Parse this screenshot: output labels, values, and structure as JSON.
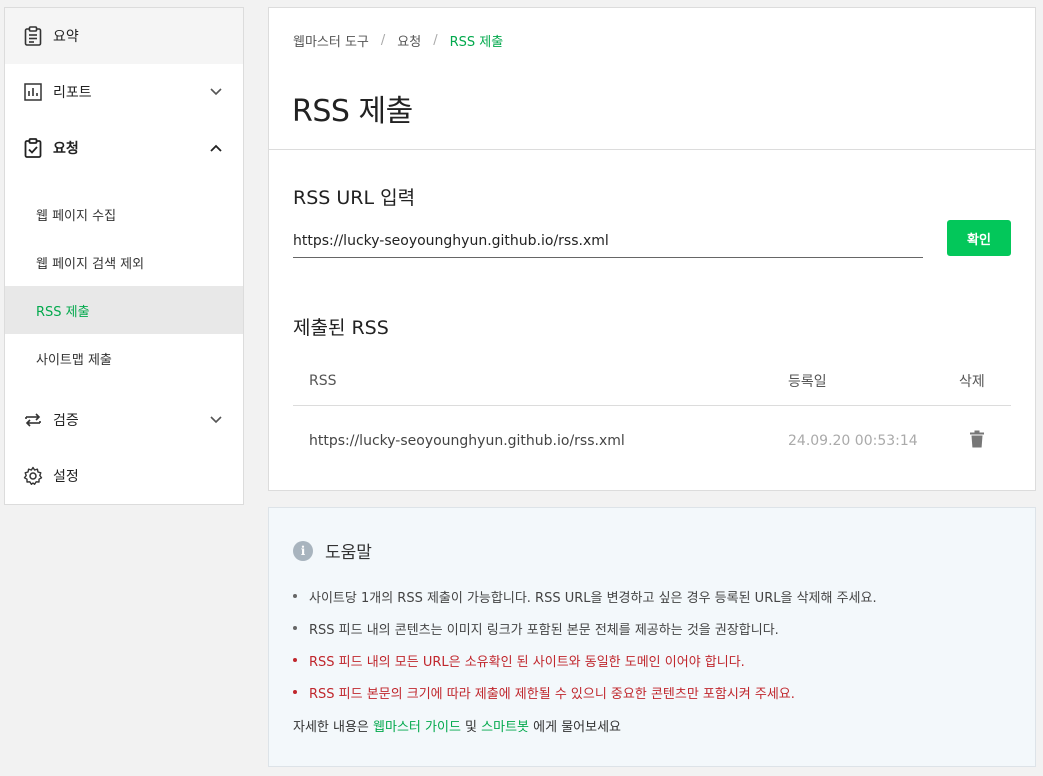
{
  "sidebar": {
    "summary": "요약",
    "reports": "리포트",
    "requests": "요청",
    "sub_items": [
      "웹 페이지 수집",
      "웹 페이지 검색 제외",
      "RSS 제출",
      "사이트맵 제출"
    ],
    "verify": "검증",
    "settings": "설정"
  },
  "breadcrumb": {
    "root": "웹마스터 도구",
    "sep": "/",
    "mid": "요청",
    "current": "RSS 제출"
  },
  "page_title": "RSS 제출",
  "input_section": {
    "title": "RSS URL 입력",
    "value": "https://lucky-seoyounghyun.github.io/rss.xml",
    "button": "확인"
  },
  "submitted": {
    "title": "제출된 RSS",
    "headers": {
      "rss": "RSS",
      "date": "등록일",
      "delete": "삭제"
    },
    "rows": [
      {
        "rss": "https://lucky-seoyounghyun.github.io/rss.xml",
        "date": "24.09.20 00:53:14"
      }
    ]
  },
  "help": {
    "title": "도움말",
    "items": [
      "사이트당 1개의 RSS 제출이 가능합니다. RSS URL을 변경하고 싶은 경우 등록된 URL을 삭제해 주세요.",
      "RSS 피드 내의 콘텐츠는 이미지 링크가 포함된 본문 전체를 제공하는 것을 권장합니다.",
      "RSS 피드 내의 모든 URL은 소유확인 된 사이트와 동일한 도메인 이어야 합니다.",
      "RSS 피드 본문의 크기에 따라 제출에 제한될 수 있으니 중요한 콘텐츠만 포함시켜 주세요."
    ],
    "footer_prefix": "자세한 내용은",
    "footer_link1": "웹마스터 가이드",
    "footer_and": "및",
    "footer_link2": "스마트봇",
    "footer_suffix": "에게 물어보세요"
  },
  "colors": {
    "accent": "#03c75a",
    "accent_text": "#03a94d",
    "warning": "#c0272d"
  }
}
